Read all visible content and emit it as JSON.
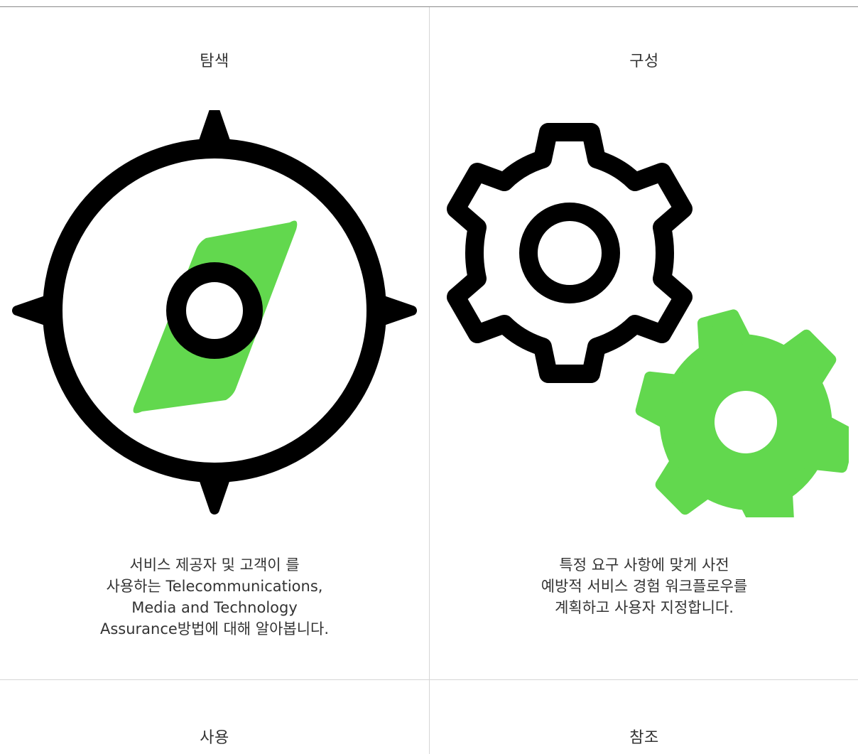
{
  "cards": [
    {
      "title": "탐색",
      "description_lines": [
        "서비스 제공자 및 고객이 를",
        "사용하는 Telecommunications,",
        "Media and Technology",
        "Assurance방법에 대해 알아봅니다."
      ],
      "icon": "compass-icon"
    },
    {
      "title": "구성",
      "description_lines": [
        "특정 요구 사항에 맞게 사전",
        "예방적 서비스 경험 워크플로우를",
        "계획하고 사용자 지정합니다."
      ],
      "icon": "gears-icon"
    },
    {
      "title": "사용"
    },
    {
      "title": "참조"
    }
  ],
  "colors": {
    "accent_green": "#62d84e",
    "icon_black": "#000000",
    "divider": "#d6d6d6"
  }
}
